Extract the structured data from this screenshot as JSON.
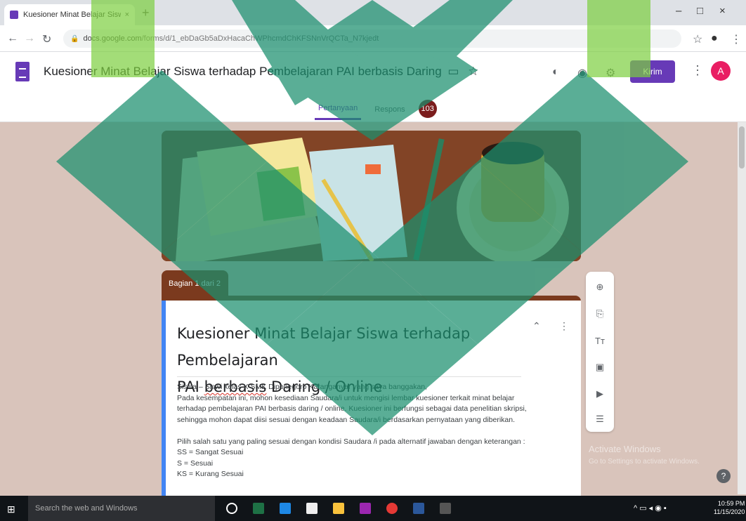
{
  "browser": {
    "tab_title": "Kuesioner Minat Belajar Siswa",
    "tab_close": "×",
    "new_tab": "+",
    "window_controls": [
      "–",
      "□",
      "×"
    ],
    "url_host": "docs.google.com",
    "url_path": "/forms/d/1_ebDaGb5aDxHacaChWPhcmdChKFSNnVrQCTa_N7kjedt",
    "icons": [
      "back-icon",
      "forward-icon",
      "reload-icon",
      "lock-icon",
      "star-icon",
      "profile-icon",
      "menu-icon"
    ]
  },
  "header": {
    "form_name": "Kuesioner Minat Belajar Siswa terhadap Pembelajaran PAI berbasis Daring",
    "send_label": "Kirim",
    "avatar_letter": "A",
    "tabs": [
      {
        "label": "Pertanyaan",
        "active": true
      },
      {
        "label": "Respons",
        "active": false
      }
    ],
    "response_count": "103",
    "accent_color": "#673ab7"
  },
  "section": {
    "tag": "Bagian 1 dari 2",
    "color": "#7b3a1e"
  },
  "card": {
    "title_part1": "Kuesioner Minat Belajar Siswa terhadap Pembelajaran",
    "title_part2_prefix": "PAI ",
    "title_part2_underlined": "berbasis",
    "title_part2_suffix": " Daring / Online",
    "desc_lines": [
      "Siswa – Siswi kelas X SMK Diponegoro Karanganyar yang saya banggakan,",
      "Pada kesempatan ini, mohon kesediaan Saudara/i untuk mengisi lembar kuesioner terkait minat belajar",
      "terhadap pembelajaran PAI berbasis daring / online. Kuesioner ini berfungsi sebagai data penelitian skripsi,",
      "sehingga mohon dapat diisi sesuai dengan keadaan Saudara/i berdasarkan pernyataan yang diberikan.",
      "",
      "Pilih salah satu yang paling sesuai dengan kondisi Saudara /i pada alternatif jawaban dengan keterangan :",
      "SS = Sangat Sesuai",
      "S   = Sesuai",
      "KS = Kurang Sesuai"
    ]
  },
  "windows": {
    "watermark_title": "Activate Windows",
    "watermark_sub": "Go to Settings to activate Windows.",
    "search_placeholder": "Search the web and Windows",
    "time": "10:59 PM",
    "date": "11/15/2020"
  }
}
